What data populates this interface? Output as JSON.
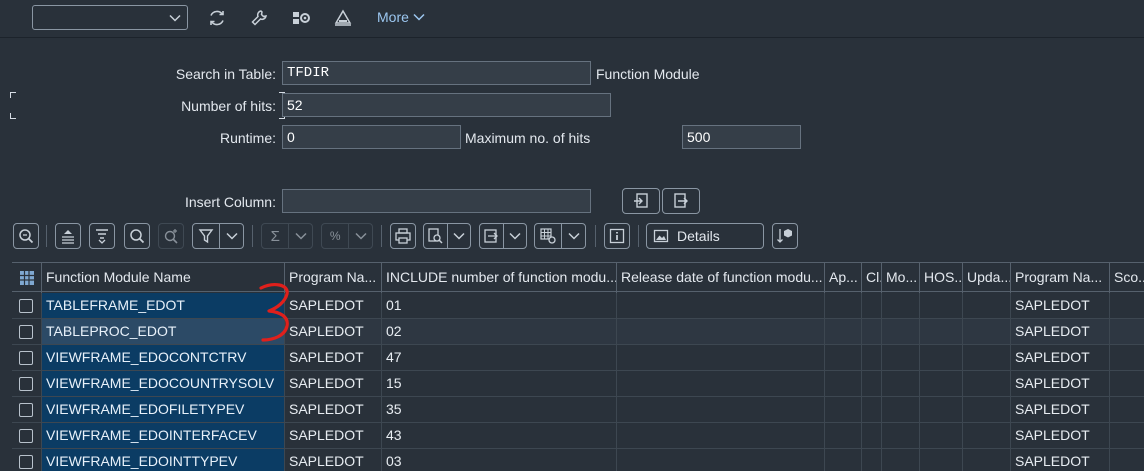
{
  "toolbar": {
    "select_value": "",
    "more_label": "More",
    "icons": [
      "refresh-icon",
      "wrench-icon",
      "settings-tree-icon",
      "triangle-icon"
    ]
  },
  "form": {
    "search_label": "Search in Table:",
    "search_value": "TFDIR",
    "search_desc": "Function Module",
    "hits_label": "Number of hits:",
    "hits_value": "52",
    "runtime_label": "Runtime:",
    "runtime_value": "0",
    "maxhits_label": "Maximum no. of hits",
    "maxhits_value": "500",
    "insert_label": "Insert Column:",
    "insert_value": ""
  },
  "grid_toolbar": {
    "details_label": "Details",
    "sum_glyph": "Σ",
    "subtotal_glyph": "%",
    "info_glyph": "i"
  },
  "table": {
    "columns": [
      "Function Module Name",
      "Program Na...",
      "INCLUDE number of function modu...",
      "Release date of function modu...",
      "Ap...",
      "Cl...",
      "Mo...",
      "HOS...",
      "Upda...",
      "Program Na...",
      "Sco..."
    ],
    "rows": [
      {
        "name": "TABLEFRAME_EDOT",
        "prog": "SAPLEDOT",
        "incl": "01",
        "prog2": "SAPLEDOT"
      },
      {
        "name": "TABLEPROC_EDOT",
        "prog": "SAPLEDOT",
        "incl": "02",
        "prog2": "SAPLEDOT"
      },
      {
        "name": "VIEWFRAME_EDOCONTCTRV",
        "prog": "SAPLEDOT",
        "incl": "47",
        "prog2": "SAPLEDOT"
      },
      {
        "name": "VIEWFRAME_EDOCOUNTRYSOLV",
        "prog": "SAPLEDOT",
        "incl": "15",
        "prog2": "SAPLEDOT"
      },
      {
        "name": "VIEWFRAME_EDOFILETYPEV",
        "prog": "SAPLEDOT",
        "incl": "35",
        "prog2": "SAPLEDOT"
      },
      {
        "name": "VIEWFRAME_EDOINTERFACEV",
        "prog": "SAPLEDOT",
        "incl": "43",
        "prog2": "SAPLEDOT"
      },
      {
        "name": "VIEWFRAME_EDOINTTYPEV",
        "prog": "SAPLEDOT",
        "incl": "03",
        "prog2": "SAPLEDOT"
      }
    ]
  },
  "colors": {
    "background": "#29313a",
    "key_column": "#0b3c64",
    "link": "#9cc7f0",
    "annotation": "#e0201c"
  }
}
